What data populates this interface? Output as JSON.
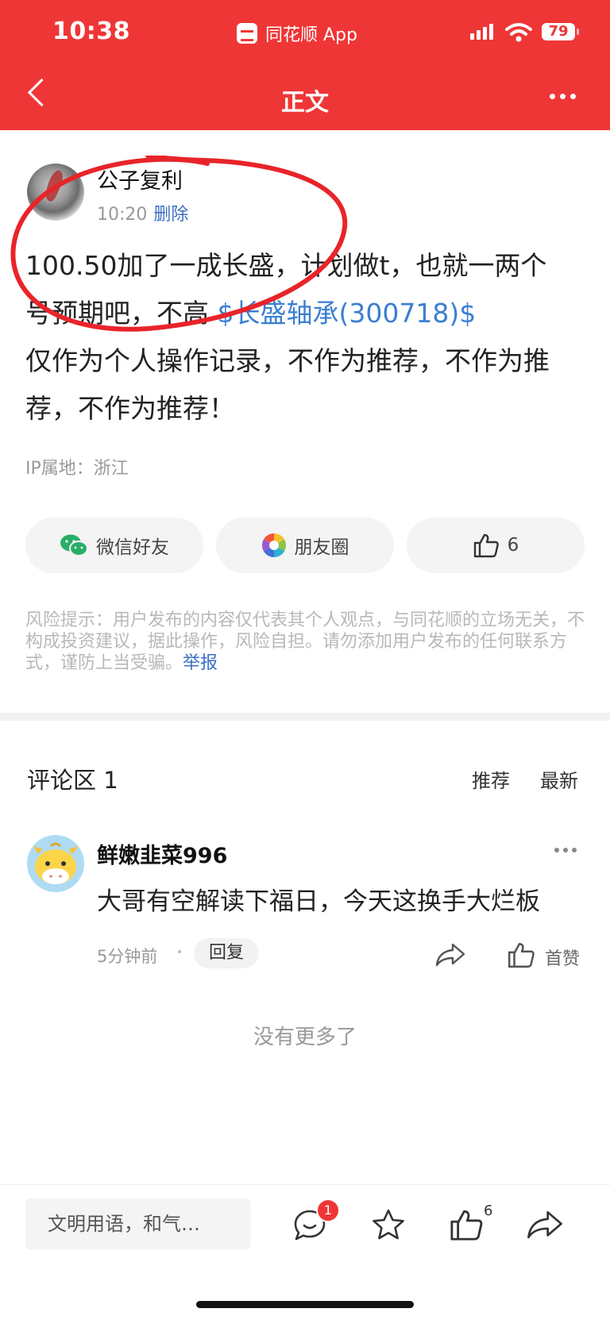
{
  "status_bar": {
    "time": "10:38",
    "app_name": "同花顺 App",
    "battery": "79"
  },
  "header": {
    "title": "正文"
  },
  "post": {
    "author": "公子复利",
    "time": "10:20",
    "delete_label": "删除",
    "line1": "100.50加了一成长盛，计划做t，也就一两个",
    "line2_prefix": "号预期吧，不高 ",
    "stock_link": "$长盛轴承(300718)$",
    "line3": "仅作为个人操作记录，不作为推荐，不作为推",
    "line4": "荐，不作为推荐！",
    "ip_location": "IP属地：浙江"
  },
  "share": {
    "wechat_label": "微信好友",
    "moments_label": "朋友圈",
    "like_count": "6"
  },
  "risk": {
    "text": "风险提示：用户发布的内容仅代表其个人观点，与同花顺的立场无关，不构成投资建议，据此操作，风险自担。请勿添加用户发布的任何联系方式，谨防上当受骗。",
    "report_label": "举报"
  },
  "comments": {
    "title": "评论区 1",
    "sort_recommend": "推荐",
    "sort_latest": "最新",
    "items": [
      {
        "user": "鲜嫩韭菜996",
        "text": "大哥有空解读下福日，今天这换手大烂板",
        "time": "5分钟前",
        "reply_label": "回复",
        "like_label": "首赞"
      }
    ],
    "no_more": "没有更多了"
  },
  "bottom_bar": {
    "input_placeholder": "文明用语，和气…",
    "comment_badge": "1",
    "like_count": "6"
  },
  "colors": {
    "brand_red": "#ef3636",
    "link_blue": "#3a7fd0"
  }
}
